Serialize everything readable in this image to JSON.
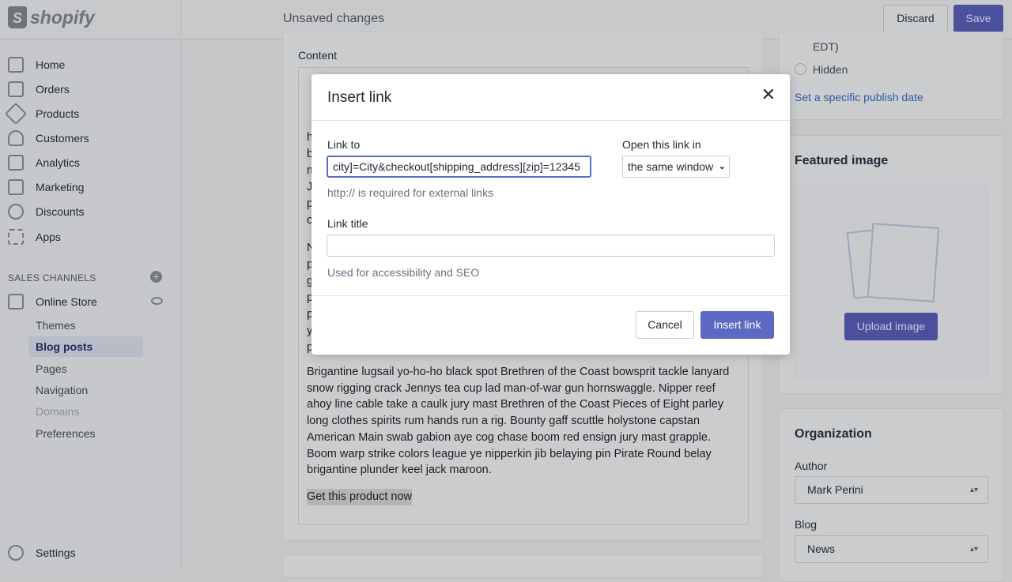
{
  "brand": "shopify",
  "topbar": {
    "status": "Unsaved changes",
    "discard": "Discard",
    "save": "Save"
  },
  "sidebar": {
    "items": [
      {
        "label": "Home",
        "icon": "home-icon"
      },
      {
        "label": "Orders",
        "icon": "orders-icon"
      },
      {
        "label": "Products",
        "icon": "tag-icon"
      },
      {
        "label": "Customers",
        "icon": "person-icon"
      },
      {
        "label": "Analytics",
        "icon": "bar-chart-icon"
      },
      {
        "label": "Marketing",
        "icon": "megaphone-icon"
      },
      {
        "label": "Discounts",
        "icon": "discount-icon"
      },
      {
        "label": "Apps",
        "icon": "apps-icon"
      }
    ],
    "sales_channels": "SALES CHANNELS",
    "online_store": "Online Store",
    "sub": [
      "Themes",
      "Blog posts",
      "Pages",
      "Navigation",
      "Domains",
      "Preferences"
    ],
    "settings": "Settings"
  },
  "content": {
    "label": "Content",
    "fragments1": [
      "h",
      "b",
      "m",
      "J",
      "p",
      "c"
    ],
    "fragments2": [
      "N",
      "p",
      "g",
      "p",
      "p",
      "y",
      "p"
    ],
    "paragraph": "Brigantine lugsail yo-ho-ho black spot Brethren of the Coast bowsprit tackle lanyard snow rigging crack Jennys tea cup lad man-of-war gun hornswaggle. Nipper reef ahoy line cable take a caulk jury mast Brethren of the Coast Pieces of Eight parley long clothes spirits rum hands run a rig. Bounty gaff scuttle holystone capstan American Main swab gabion aye cog chase boom red ensign jury mast grapple. Boom warp strike colors league ye nipperkin jib belaying pin Pirate Round belay brigantine plunder keel jack maroon.",
    "link_text": "Get this product now"
  },
  "modal": {
    "title": "Insert link",
    "link_to_label": "Link to",
    "link_to_value": "city]=City&checkout[shipping_address][zip]=12345",
    "link_help": "http:// is required for external links",
    "open_in_label": "Open this link in",
    "open_in_value": "the same window",
    "title_label": "Link title",
    "title_value": "",
    "title_help": "Used for accessibility and SEO",
    "cancel": "Cancel",
    "insert": "Insert link"
  },
  "visibility": {
    "edt": "EDT)",
    "hidden": "Hidden",
    "set_date": "Set a specific publish date"
  },
  "featured": {
    "title": "Featured image",
    "upload": "Upload image"
  },
  "organization": {
    "title": "Organization",
    "author_label": "Author",
    "author": "Mark Perini",
    "blog_label": "Blog",
    "blog": "News"
  },
  "colors": {
    "primary": "#5c6ac4",
    "link": "#2c6ecb"
  }
}
